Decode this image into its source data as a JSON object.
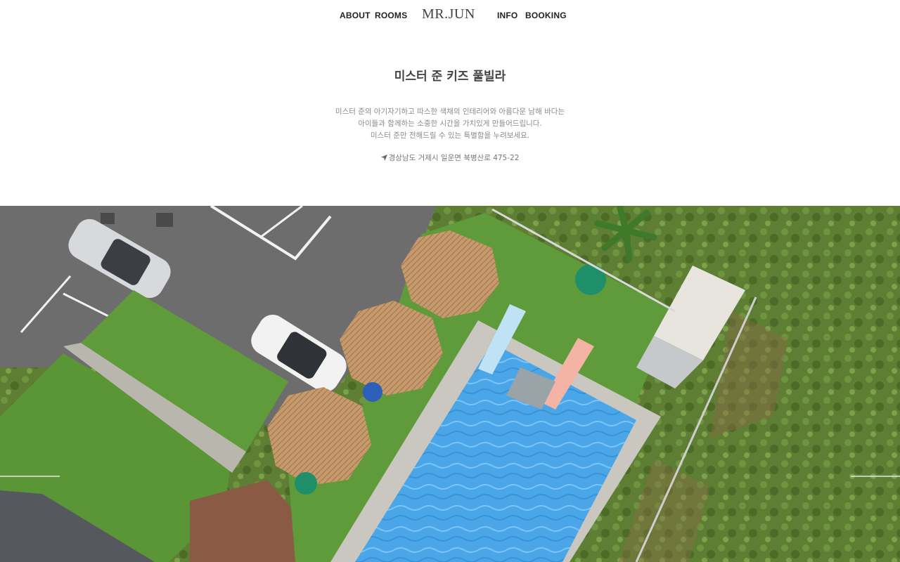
{
  "nav": {
    "about": "ABOUT",
    "rooms": "ROOMS",
    "logo": "MR.JUN",
    "info": "INFO",
    "booking": "BOOKING"
  },
  "intro": {
    "title": "미스터 준 키즈 풀빌라",
    "description": [
      "미스터 준의 아기자기하고 따스한 색채의 인테리어와 아름다운 남해 바다는",
      "아이들과 함께하는 소중한 시간을 가치있게 만들어드립니다.",
      "미스터 준만 전해드릴 수 있는 특별함을 누려보세요."
    ],
    "address": "경상남도 거제시 일운면 북병산로 475-22",
    "address_icon": "location-arrow-icon"
  },
  "photo": {
    "subject": "aerial-pool-villa",
    "colors": {
      "pool": "#4aa6e6",
      "turf": "#5f9b3a",
      "asphalt": "#6d6d6d",
      "umbrella": "#c69a6c",
      "vegetation": "#5e7f33"
    }
  }
}
